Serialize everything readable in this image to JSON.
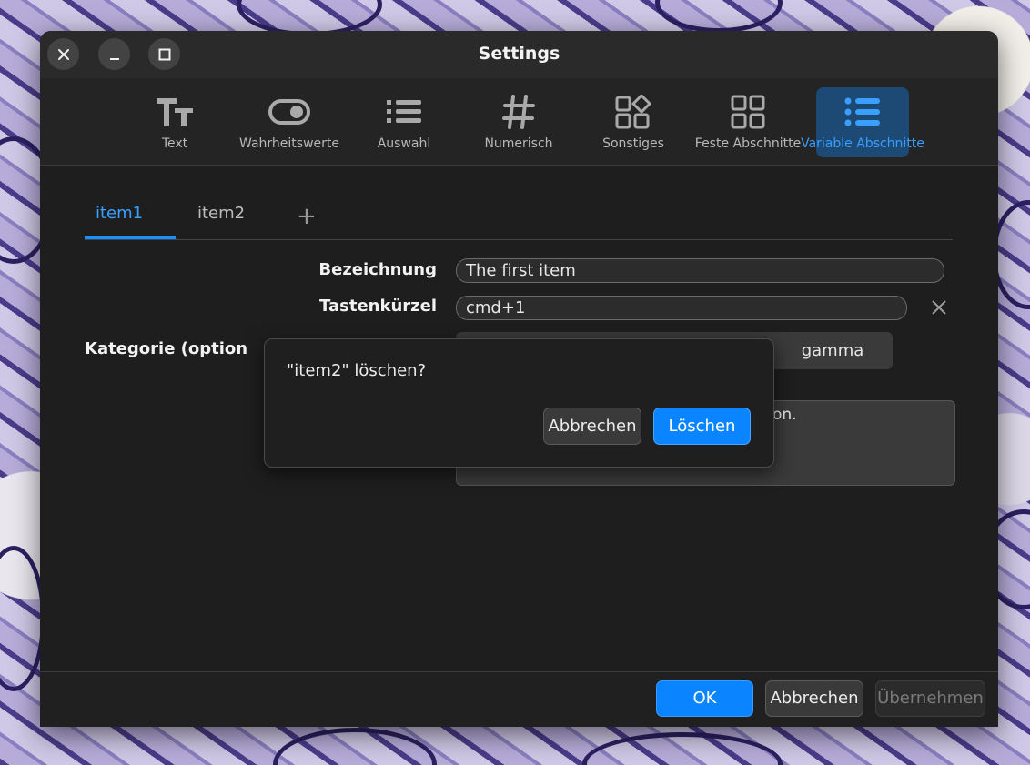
{
  "window": {
    "title": "Settings"
  },
  "toolbar": {
    "items": [
      {
        "label": "Text",
        "icon": "text-icon"
      },
      {
        "label": "Wahrheitswerte",
        "icon": "toggle-icon"
      },
      {
        "label": "Auswahl",
        "icon": "list-icon"
      },
      {
        "label": "Numerisch",
        "icon": "hash-icon"
      },
      {
        "label": "Sonstiges",
        "icon": "shapes-icon"
      },
      {
        "label": "Feste Abschnitte",
        "icon": "grid-icon"
      },
      {
        "label": "Variable Abschnitte",
        "icon": "bullet-list-icon",
        "active": true
      }
    ]
  },
  "tabs": {
    "items": [
      {
        "label": "item1",
        "active": true
      },
      {
        "label": "item2"
      }
    ],
    "add_label": "+"
  },
  "form": {
    "name_label": "Bezeichnung",
    "name_value": "The first item",
    "shortcut_label": "Tastenkürzel",
    "shortcut_value": "cmd+1",
    "category_label": "Kategorie (option",
    "category_option_visible": "gamma",
    "description_visible": "on."
  },
  "footer": {
    "ok": "OK",
    "cancel": "Abbrechen",
    "apply": "Übernehmen"
  },
  "dialog": {
    "message": "\"item2\" löschen?",
    "cancel": "Abbrechen",
    "delete": "Löschen"
  },
  "colors": {
    "accent": "#0a84ff",
    "active_tab": "#3aa0ff",
    "window_bg": "#1e1e1e"
  }
}
